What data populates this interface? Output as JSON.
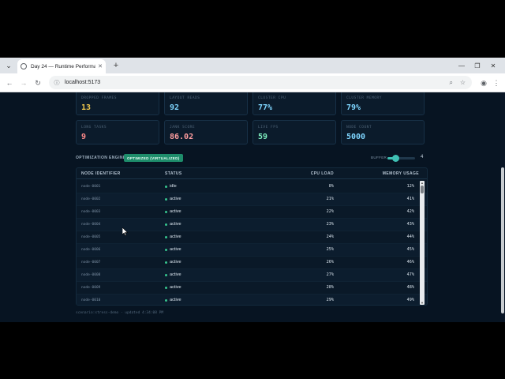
{
  "browser": {
    "tab_title": "Day 24 — Runtime Performance",
    "url": "localhost:5173"
  },
  "metrics": [
    {
      "label": "DROPPED FRAMES",
      "value": "13",
      "color": "#f2c94c"
    },
    {
      "label": "LAYOUT READS",
      "value": "92",
      "color": "#7fd6ff"
    },
    {
      "label": "CLUSTER CPU",
      "value": "77%",
      "color": "#7fd6ff"
    },
    {
      "label": "CLUSTER MEMORY",
      "value": "79%",
      "color": "#7fd6ff"
    },
    {
      "label": "LONG TASKS",
      "value": "9",
      "color": "#ff8a8a"
    },
    {
      "label": "JANK SCORE",
      "value": "86.02",
      "color": "#ff9ea0"
    },
    {
      "label": "LIVE FPS",
      "value": "59",
      "color": "#7ff0c0"
    },
    {
      "label": "NODE COUNT",
      "value": "5000",
      "color": "#7fd6ff"
    }
  ],
  "engine": {
    "label": "OPTIMIZATION ENGINE",
    "badge": "OPTIMIZED (VIRTUALIZED)",
    "buffer_label": "BUFFER",
    "buffer_value": "4",
    "buffer_fraction": 0.3
  },
  "table": {
    "headers": {
      "id": "NODE IDENTIFIER",
      "status": "STATUS",
      "cpu": "CPU LOAD",
      "mem": "MEMORY USAGE"
    },
    "rows": [
      {
        "id": "node-0001",
        "status": "idle",
        "cpu": "8%",
        "mem": "12%"
      },
      {
        "id": "node-0002",
        "status": "active",
        "cpu": "21%",
        "mem": "41%"
      },
      {
        "id": "node-0003",
        "status": "active",
        "cpu": "22%",
        "mem": "42%"
      },
      {
        "id": "node-0004",
        "status": "active",
        "cpu": "23%",
        "mem": "43%"
      },
      {
        "id": "node-0005",
        "status": "active",
        "cpu": "24%",
        "mem": "44%"
      },
      {
        "id": "node-0006",
        "status": "active",
        "cpu": "25%",
        "mem": "45%"
      },
      {
        "id": "node-0007",
        "status": "active",
        "cpu": "26%",
        "mem": "46%"
      },
      {
        "id": "node-0008",
        "status": "active",
        "cpu": "27%",
        "mem": "47%"
      },
      {
        "id": "node-0009",
        "status": "active",
        "cpu": "28%",
        "mem": "48%"
      },
      {
        "id": "node-0010",
        "status": "active",
        "cpu": "29%",
        "mem": "49%"
      }
    ]
  },
  "footer": "scenario:stress-demo · updated 4:34:08 PM"
}
